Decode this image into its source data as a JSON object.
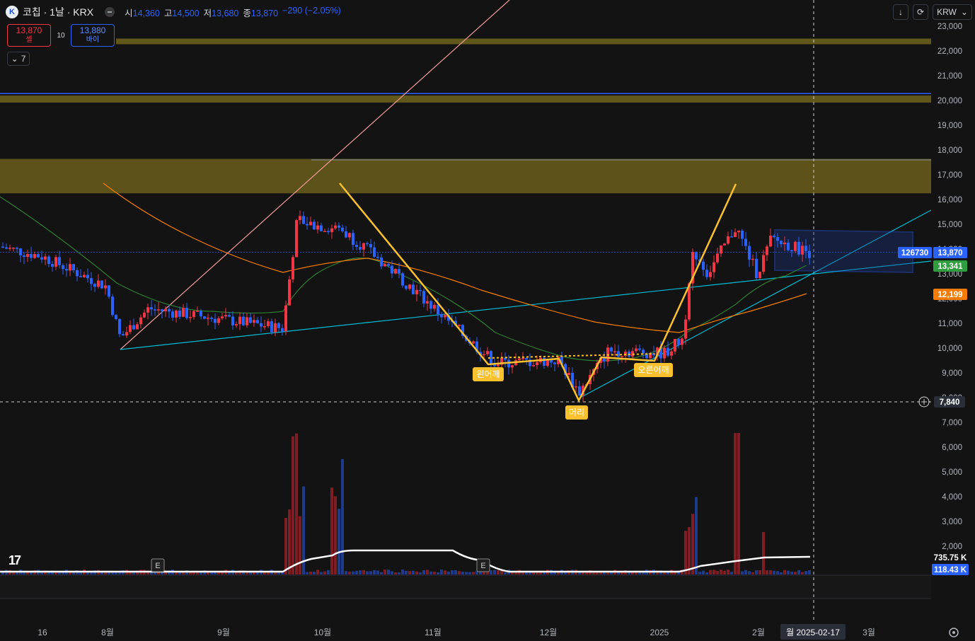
{
  "header": {
    "logo_letter": "K",
    "symbol": "코칩 · 1날 · KRX",
    "open_label": "시",
    "open": "14,360",
    "high_label": "고",
    "high": "14,500",
    "low_label": "저",
    "low": "13,680",
    "close_label": "종",
    "close": "13,870",
    "change": "−290 (−2.05%)"
  },
  "trade": {
    "sell_price": "13,870",
    "sell_label": "셀",
    "spread": "10",
    "buy_price": "13,880",
    "buy_label": "바이"
  },
  "collapse_count": "7",
  "toolbar": {
    "currency": "KRW",
    "down_icon": "arrow-down-icon",
    "refresh_icon": "refresh-icon"
  },
  "price_axis": {
    "ticks": [
      "23,000",
      "22,000",
      "21,000",
      "20,000",
      "19,000",
      "18,000",
      "17,000",
      "16,000",
      "15,000",
      "14,000",
      "13,000",
      "12,000",
      "11,000",
      "10,000",
      "9,000",
      "8,000",
      "7,000",
      "6,000",
      "5,000",
      "4,000",
      "3,000",
      "2,000"
    ],
    "last_price": "13,870",
    "ma_short": "13,341",
    "ma_long": "12,199",
    "crosshair_price": "7,840",
    "volume_label": "126730",
    "vol_ma_label": "735.75 K",
    "vol_label": "118.43 K"
  },
  "time_axis": {
    "ticks": [
      "16",
      "8월",
      "9월",
      "10월",
      "11월",
      "12월",
      "2025",
      "2월",
      "3월"
    ],
    "crosshair_date": "월 2025-02-17"
  },
  "annotations": {
    "left_shoulder": "왼어깨",
    "head": "머리",
    "right_shoulder": "오른어깨",
    "earnings": "E"
  },
  "colors": {
    "up": "#f23645",
    "down": "#2962ff",
    "ma_fast": "#2e7d32",
    "ma_slow": "#f57c00",
    "zone": "#6b5f1c",
    "pattern": "#fbc02d",
    "trend": "#00bcd4"
  }
}
